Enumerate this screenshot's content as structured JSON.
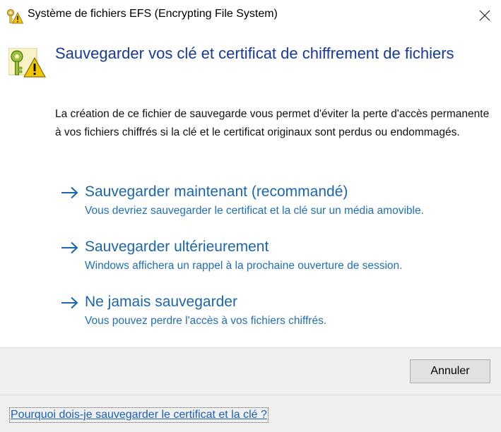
{
  "window": {
    "title": "Système de fichiers EFS (Encrypting File System)",
    "icons": {
      "app": "key-warning-icon",
      "close": "close-icon",
      "hero": "key-warning-icon"
    }
  },
  "main": {
    "heading": "Sauvegarder vos clé et certificat de chiffrement de fichiers",
    "description": "La création de ce fichier de sauvegarde vous permet d'éviter la perte d'accès permanente à vos fichiers chiffrés si la clé et le certificat originaux sont perdus ou endommagés.",
    "options": [
      {
        "title": "Sauvegarder maintenant (recommandé)",
        "description": "Vous devriez sauvegarder le certificat et la clé sur un média amovible.",
        "icon": "arrow-right-icon"
      },
      {
        "title": "Sauvegarder ultérieurement",
        "description": "Windows affichera un rappel à la prochaine ouverture de session.",
        "icon": "arrow-right-icon"
      },
      {
        "title": "Ne jamais sauvegarder",
        "description": "Vous pouvez perdre l'accès à vos fichiers chiffrés.",
        "icon": "arrow-right-icon"
      }
    ]
  },
  "footer": {
    "cancel_label": "Annuler",
    "help_link": "Pourquoi dois-je sauvegarder le certificat et la clé ?"
  },
  "colors": {
    "heading": "#17399c",
    "link": "#1b65b0",
    "footer_bg": "#f0f0f0"
  }
}
